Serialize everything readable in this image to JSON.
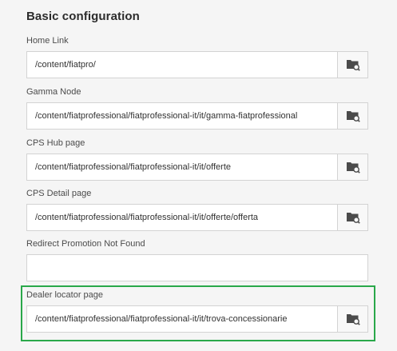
{
  "section": {
    "title": "Basic configuration"
  },
  "fields": [
    {
      "label": "Home Link",
      "value": "/content/fiatpro/",
      "has_browse": true,
      "browse_icon": "folder-search-icon"
    },
    {
      "label": "Gamma Node",
      "value": "/content/fiatprofessional/fiatprofessional-it/it/gamma-fiatprofessional",
      "has_browse": true,
      "browse_icon": "folder-search-icon"
    },
    {
      "label": "CPS Hub page",
      "value": "/content/fiatprofessional/fiatprofessional-it/it/offerte",
      "has_browse": true,
      "browse_icon": "folder-search-icon"
    },
    {
      "label": "CPS Detail page",
      "value": "/content/fiatprofessional/fiatprofessional-it/it/offerte/offerta",
      "has_browse": true,
      "browse_icon": "folder-search-icon"
    },
    {
      "label": "Redirect Promotion Not Found",
      "value": "",
      "has_browse": false
    },
    {
      "label": "Dealer locator page",
      "value": "/content/fiatprofessional/fiatprofessional-it/it/trova-concessionarie",
      "has_browse": true,
      "browse_icon": "folder-search-icon",
      "highlighted": true
    }
  ],
  "colors": {
    "background": "#f5f5f5",
    "input_border": "#d3d3d3",
    "highlight": "#2aa84a",
    "icon": "#4b4b4b"
  }
}
